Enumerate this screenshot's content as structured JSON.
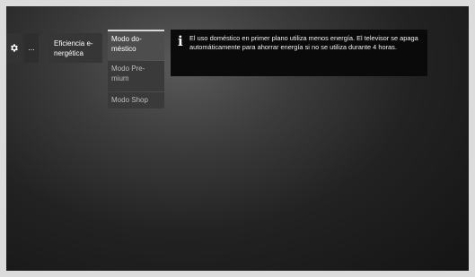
{
  "menu": {
    "more_label": "...",
    "energy_label": "Eficiencia e-\nnergética",
    "modes": [
      {
        "label": "Modo do-\nméstico",
        "selected": true
      },
      {
        "label": "Modo Pre-\nmium",
        "selected": false
      },
      {
        "label": "Modo Shop",
        "selected": false
      }
    ]
  },
  "info": {
    "icon": "info-icon",
    "text": "El uso doméstico en primer plano utiliza menos energía. El televisor se apaga automáticamente para ahorrar energía si no se utiliza durante 4 horas."
  },
  "icons": {
    "settings": "gear-icon"
  }
}
